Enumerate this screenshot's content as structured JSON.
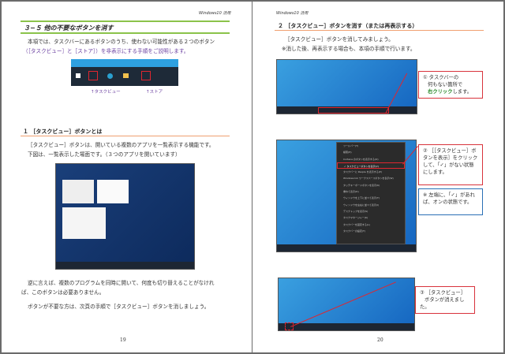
{
  "left_page": {
    "header": "Windows10 活用",
    "section_title": "３−５ 他の不要なボタンを消す",
    "intro": [
      "本項では、タスクバーにあるボタンのうち、使わない可能性がある２つのボタン",
      "（［タスクビュー］と［ストア］）を非表示にする手順をご説明します。"
    ],
    "taskbar_labels": {
      "taskview": "↑タスクビュー",
      "store": "↑ストア"
    },
    "subsection_title": "１ ［タスクビュー］ボタンとは",
    "sub_text": [
      "［タスクビュー］ボタンは、開いている複数のアプリを一覧表示する機能です。",
      "下図は、一覧表示した場面です。（３つのアプリを開いています）"
    ],
    "outro": [
      "逆に言えば、複数のプログラムを同時に開いて、何度も切り替えることがなけれ",
      "ば、このボタンは必要ありません。"
    ],
    "outro2": "ボタンが不要な方は、次頁の手順で［タスクビュー］ボタンを消しましょう。",
    "page_number": "19"
  },
  "right_page": {
    "header": "Windows10 活用",
    "section_title": "２ ［タスクビュー］ボタンを消す（または再表示する）",
    "intro": [
      "［タスクビュー］ボタンを消してみましょう。",
      "※消した後、再表示する場合も、本項の手順で行います。"
    ],
    "callout1": {
      "num": "①",
      "l1": "タスクバーの",
      "l2": "何もない箇所で",
      "em": "右クリック",
      "l3": "します。"
    },
    "callout2": {
      "num": "②",
      "text": "［［タスクビュー］ボタンを表示］をクリックして、「✓」がない状態にします。"
    },
    "callout_note": {
      "num": "※",
      "text": "左端に、「✓」があれば、オンの状態です。"
    },
    "callout3": {
      "num": "③",
      "l1": "［タスクビュー］",
      "l2": "ボタンが消えました。"
    },
    "context_menu": [
      "ツールバー(T)",
      "検索(H)",
      "Cortana のボタンを表示する(O)",
      "✓ タスクビューボタンを表示(V)",
      "タスクバーに People を表示する(P)",
      "Windows Ink ワークスペースボタンを表示(W)",
      "タッチキーボードボタンを表示(K)",
      "重ねて表示(D)",
      "ウィンドウを上下に並べて表示(T)",
      "ウィンドウを左右に並べて表示(I)",
      "デスクトップを表示(S)",
      "タスクマネージャー(K)",
      "タスクバーを固定する(L)",
      "タスクバーの設定(T)"
    ],
    "page_number": "20"
  },
  "colors": {
    "green": "#8bc34a",
    "orange": "#f0a070",
    "red": "#d8333c",
    "blue": "#2a6fb5"
  }
}
